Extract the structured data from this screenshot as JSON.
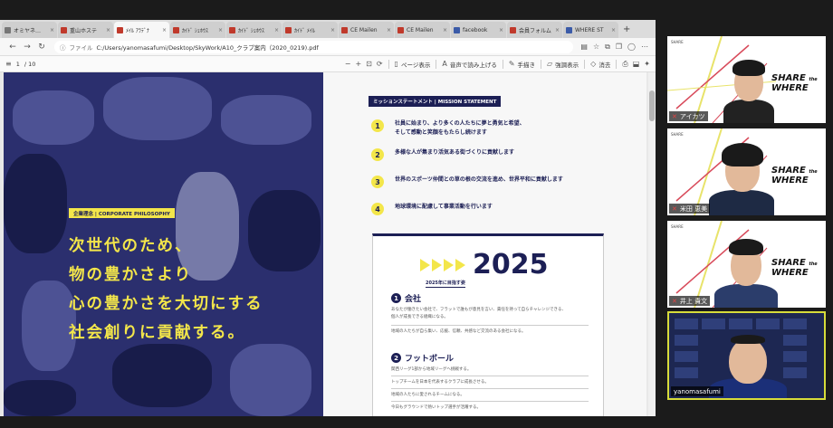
{
  "browser": {
    "tabs": [
      {
        "label": "オミヤネ…",
        "active": false
      },
      {
        "label": "重山ホステ",
        "active": false
      },
      {
        "label": "ﾒｲﾙ ｱﾗﾃﾞﾅ",
        "active": true
      },
      {
        "label": "ｶｲﾄﾞ ｼｪﾎｳｽ",
        "active": false
      },
      {
        "label": "ｶｲﾄﾞ ｼｪﾎｳｽ",
        "active": false
      },
      {
        "label": "ｶｲﾄﾞ ﾒｲﾙ",
        "active": false
      },
      {
        "label": "CE Mailen",
        "active": false
      },
      {
        "label": "CE Mailen",
        "active": false
      },
      {
        "label": "facebook",
        "active": false
      },
      {
        "label": "会員フォルム",
        "active": false
      },
      {
        "label": "WHERE ST",
        "active": false
      }
    ],
    "address": {
      "label": "ファイル",
      "url": "C:/Users/yanomasafumi/Desktop/SkyWork/A10_クラブ案内（2020_0219).pdf"
    },
    "toolbar": {
      "page": "1",
      "page_total": "/ 10",
      "zoom_out": "−",
      "zoom_in": "+",
      "page_view": "ページ表示",
      "read_aloud": "音声で読み上げる",
      "draw": "手描き",
      "highlight": "強調表示",
      "erase": "消去"
    }
  },
  "pdf": {
    "left": {
      "badge": "企業理念 | CORPORATE PHILOSOPHY",
      "slogan": [
        "次世代のため、",
        "物の豊かさより",
        "心の豊かさを大切にする",
        "社会創りに貢献する。"
      ]
    },
    "right": {
      "badge": "ミッションステートメント | MISSION STATEMENT",
      "missions": [
        {
          "num": "1",
          "text": [
            "社員に始まり、より多くの人たちに夢と勇気と希望、",
            "そして感動と笑顔をもたらし続けます"
          ]
        },
        {
          "num": "2",
          "text": [
            "多様な人が集まり活気ある街づくりに貢献します"
          ]
        },
        {
          "num": "3",
          "text": [
            "世界のスポーツ仲間との草の根の交流を進め、世界平和に貢献します"
          ]
        },
        {
          "num": "4",
          "text": [
            "地球環境に配慮して事業活動を行います"
          ]
        }
      ],
      "card": {
        "year": "2025",
        "subtitle": "2025年に目指す姿",
        "sections": [
          {
            "num": "1",
            "title": "会社",
            "lines": [
              "あなたが働きたい会社で、フラットで誰もが意見を言い、責任を持って自らチャレンジできる、",
              "個人が成長できる組織になる。",
              "地域の人たちが自ら集い、応援、信頼、共感など交流のある会社になる。"
            ]
          },
          {
            "num": "2",
            "title": "フットボール",
            "lines": [
              "関西リーグ1部から地域リーグへ挑戦する。",
              "トップチームを日本を代表するクラブに成長させる。",
              "地域の人たちに愛されるチームになる。",
              "今日もグラウンドで熱いトップ選手が活躍する。"
            ]
          }
        ]
      }
    }
  },
  "participants": [
    {
      "name": "アイカツ",
      "muted": true
    },
    {
      "name": "米田 恵美",
      "muted": true
    },
    {
      "name": "井上 貴文",
      "muted": true
    },
    {
      "name": "yanomasafumi",
      "muted": false
    }
  ],
  "branding": {
    "line1": "SHARE",
    "line1_small": "the",
    "line2": "WHERE",
    "small_tag": "SHARE"
  }
}
